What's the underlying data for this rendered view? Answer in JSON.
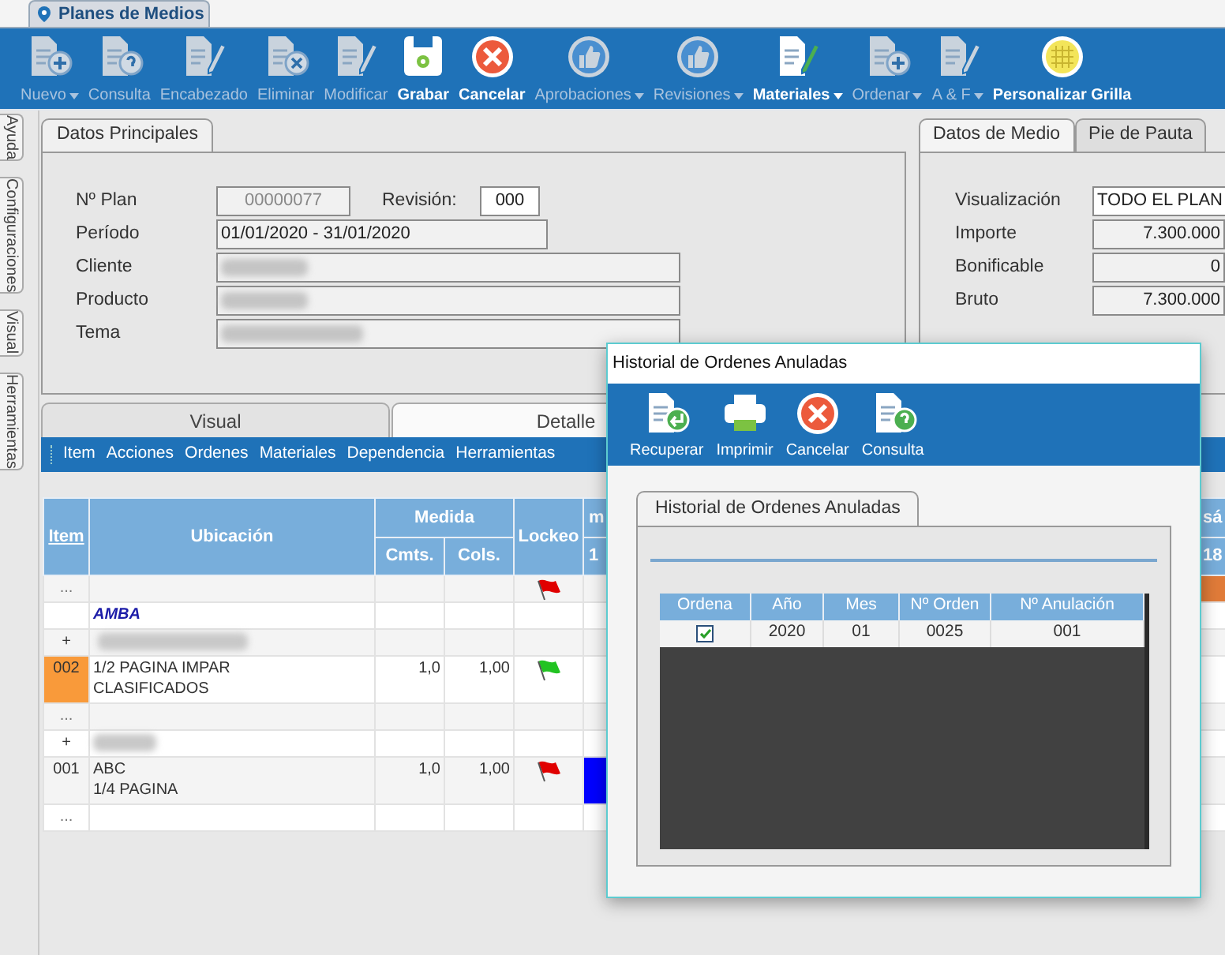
{
  "window_tab": {
    "title": "Planes de Medios"
  },
  "toolbar": [
    {
      "label": "Nuevo",
      "kind": "doc-plus",
      "enabled": false,
      "dropdown": true
    },
    {
      "label": "Consulta",
      "kind": "doc-question",
      "enabled": false,
      "dropdown": false
    },
    {
      "label": "Encabezado",
      "kind": "doc-pencil",
      "enabled": false,
      "dropdown": false
    },
    {
      "label": "Eliminar",
      "kind": "doc-x",
      "enabled": false,
      "dropdown": false
    },
    {
      "label": "Modificar",
      "kind": "doc-pencil",
      "enabled": false,
      "dropdown": false
    },
    {
      "label": "Grabar",
      "kind": "save",
      "enabled": true,
      "dropdown": false
    },
    {
      "label": "Cancelar",
      "kind": "cancel",
      "enabled": true,
      "dropdown": false
    },
    {
      "label": "Aprobaciones",
      "kind": "thumb",
      "enabled": false,
      "dropdown": true
    },
    {
      "label": "Revisiones",
      "kind": "thumb",
      "enabled": false,
      "dropdown": true
    },
    {
      "label": "Materiales",
      "kind": "doc-pencil-green",
      "enabled": true,
      "dropdown": true
    },
    {
      "label": "Ordenar",
      "kind": "doc-plus",
      "enabled": false,
      "dropdown": true
    },
    {
      "label": "A & F",
      "kind": "doc-pencil",
      "enabled": false,
      "dropdown": true
    },
    {
      "label": "Personalizar Grilla",
      "kind": "grid",
      "enabled": true,
      "dropdown": false
    }
  ],
  "side_tabs": [
    "Ayuda",
    "Configuraciones",
    "Visual",
    "Herramientas"
  ],
  "main_panel": {
    "tab": "Datos Principales",
    "plan": {
      "label": "Nº Plan",
      "value": "00000077"
    },
    "revision": {
      "label": "Revisión:",
      "value": "000"
    },
    "fields": [
      {
        "label": "Período",
        "value": "01/01/2020 - 31/01/2020",
        "redacted": false
      },
      {
        "label": "Cliente",
        "redacted": true
      },
      {
        "label": "Producto",
        "redacted": true
      },
      {
        "label": "Tema",
        "redacted": true
      }
    ]
  },
  "side_panel": {
    "tabs": [
      {
        "label": "Datos de Medio",
        "selected": true
      },
      {
        "label": "Pie de Pauta",
        "selected": false
      }
    ],
    "fields": [
      {
        "label": "Visualización",
        "value": "TODO EL PLAN",
        "kind": "select"
      },
      {
        "label": "Importe",
        "value": "7.300.000",
        "kind": "number"
      },
      {
        "label": "Bonificable",
        "value": "0",
        "kind": "number"
      },
      {
        "label": "Bruto",
        "value": "7.300.000",
        "kind": "number"
      }
    ]
  },
  "lower_tabs": [
    {
      "label": "Visual",
      "selected": false
    },
    {
      "label": "Detalle",
      "selected": true
    }
  ],
  "menu": [
    "Item",
    "Acciones",
    "Ordenes",
    "Materiales",
    "Dependencia",
    "Herramientas"
  ],
  "grid": {
    "columns": {
      "item": "Item",
      "ubicacion": "Ubicación",
      "medida": "Medida",
      "cmts": "Cmts.",
      "cols": "Cols.",
      "lockeo": "Lockeo",
      "day_first": "m",
      "day_first_num": "1",
      "day_last": "sá",
      "day_last_num": "18"
    },
    "rows": [
      {
        "kind": "ellipsis",
        "item": "...",
        "selected": false,
        "flag": {
          "color": "#e00000"
        },
        "day_last": {
          "color": "#e07b39"
        }
      },
      {
        "kind": "group",
        "ubicacion": "AMBA",
        "selected": false
      },
      {
        "kind": "redacted",
        "item": "+",
        "selected": false
      },
      {
        "kind": "item",
        "item": "002",
        "lines": [
          "1/2 PAGINA IMPAR",
          "CLASIFICADOS"
        ],
        "cmts": "1,0",
        "cols": "1,00",
        "selected": true,
        "flag": {
          "color": "#22c322"
        }
      },
      {
        "kind": "ellipsis",
        "item": "...",
        "selected": false
      },
      {
        "kind": "redacted",
        "item": "+",
        "selected": false
      },
      {
        "kind": "item",
        "item": "001",
        "lines": [
          "ABC",
          "1/4 PAGINA"
        ],
        "cmts": "1,0",
        "cols": "1,00",
        "selected": false,
        "flag": {
          "color": "#e00000"
        },
        "day_first": {
          "color": "#0000ff"
        }
      },
      {
        "kind": "ellipsis",
        "item": "...",
        "selected": false
      }
    ]
  },
  "dialog": {
    "title": "Historial de Ordenes Anuladas",
    "toolbar": [
      {
        "label": "Recuperar",
        "kind": "recover"
      },
      {
        "label": "Imprimir",
        "kind": "print"
      },
      {
        "label": "Cancelar",
        "kind": "cancel"
      },
      {
        "label": "Consulta",
        "kind": "doc-question"
      }
    ],
    "tab": "Historial de Ordenes Anuladas",
    "columns": [
      "Ordena",
      "Año",
      "Mes",
      "Nº Orden",
      "Nº Anulación"
    ],
    "rows": [
      {
        "checked": true,
        "cells": [
          "",
          "2020",
          "01",
          "0025",
          "001"
        ]
      }
    ]
  }
}
